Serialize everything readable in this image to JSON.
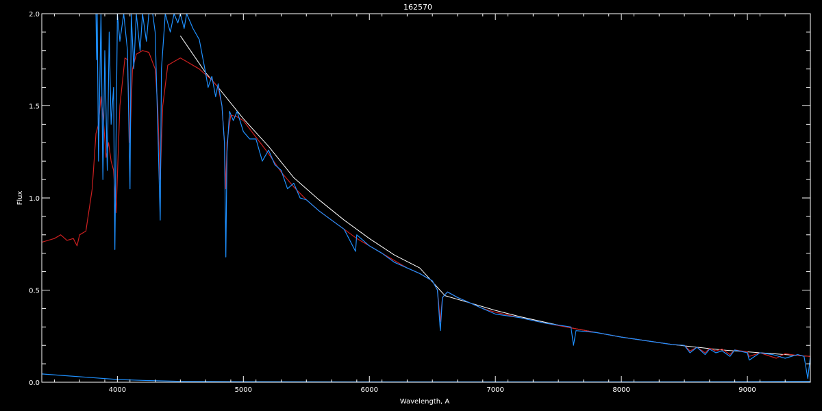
{
  "chart_data": {
    "type": "line",
    "title": "162570",
    "xlabel": "Wavelength, A",
    "ylabel": "Flux",
    "xlim": [
      3400,
      9500
    ],
    "ylim": [
      0.0,
      2.0
    ],
    "xticks": [
      4000,
      5000,
      6000,
      7000,
      8000,
      9000
    ],
    "yticks": [
      "0.0",
      "0.5",
      "1.0",
      "1.5",
      "2.0"
    ],
    "ytick_values": [
      0.0,
      0.5,
      1.0,
      1.5,
      2.0
    ],
    "grid": false,
    "legend": "none",
    "colors": {
      "background": "#000000",
      "axes": "#ffffff",
      "observed": "#1e90ff",
      "model": "#cc2020",
      "reference": "#ffffff",
      "error": "#1e90ff"
    },
    "series": [
      {
        "key": "reference",
        "x": [
          4500,
          4600,
          4700,
          4800,
          5000,
          5200,
          5400,
          5600,
          5800,
          6000,
          6200,
          6400,
          6600,
          6800,
          7000,
          7200,
          7400,
          7600,
          7800,
          8000,
          8200,
          8400,
          8600,
          8800,
          9000,
          9200,
          9400,
          9500
        ],
        "y": [
          1.88,
          1.78,
          1.68,
          1.6,
          1.43,
          1.28,
          1.11,
          0.99,
          0.88,
          0.78,
          0.69,
          0.62,
          0.47,
          0.43,
          0.39,
          0.355,
          0.325,
          0.295,
          0.27,
          0.245,
          0.225,
          0.205,
          0.19,
          0.175,
          0.165,
          0.155,
          0.145,
          0.14
        ]
      },
      {
        "key": "model",
        "x": [
          3400,
          3500,
          3550,
          3600,
          3650,
          3680,
          3700,
          3750,
          3800,
          3830,
          3850,
          3870,
          3890,
          3910,
          3930,
          3950,
          3970,
          3990,
          4020,
          4060,
          4080,
          4100,
          4120,
          4150,
          4200,
          4250,
          4300,
          4320,
          4340,
          4360,
          4400,
          4450,
          4500,
          4550,
          4600,
          4650,
          4700,
          4750,
          4800,
          4830,
          4850,
          4861,
          4870,
          4900,
          4950,
          5000,
          5100,
          5200,
          5300,
          5400,
          5500,
          5600,
          5700,
          5800,
          5900,
          6000,
          6100,
          6200,
          6300,
          6400,
          6500,
          6540,
          6563,
          6580,
          6620,
          6700,
          6800,
          6900,
          7000,
          7200,
          7400,
          7600,
          7800,
          8000,
          8200,
          8400,
          8500,
          8545,
          8600,
          8665,
          8700,
          8750,
          8800,
          8862,
          8900,
          9000,
          9015,
          9100,
          9229,
          9300,
          9400,
          9500
        ],
        "y": [
          0.76,
          0.78,
          0.8,
          0.77,
          0.78,
          0.74,
          0.8,
          0.82,
          1.05,
          1.35,
          1.4,
          1.55,
          1.42,
          1.22,
          1.3,
          1.2,
          1.15,
          0.92,
          1.5,
          1.76,
          1.75,
          1.3,
          1.7,
          1.78,
          1.8,
          1.79,
          1.7,
          1.5,
          1.1,
          1.5,
          1.72,
          1.74,
          1.76,
          1.74,
          1.72,
          1.7,
          1.67,
          1.64,
          1.6,
          1.5,
          1.3,
          1.05,
          1.3,
          1.45,
          1.44,
          1.42,
          1.33,
          1.24,
          1.14,
          1.06,
          0.99,
          0.93,
          0.88,
          0.83,
          0.78,
          0.74,
          0.7,
          0.66,
          0.62,
          0.59,
          0.55,
          0.5,
          0.33,
          0.46,
          0.49,
          0.46,
          0.43,
          0.4,
          0.38,
          0.35,
          0.32,
          0.295,
          0.27,
          0.245,
          0.225,
          0.205,
          0.2,
          0.17,
          0.19,
          0.16,
          0.185,
          0.17,
          0.18,
          0.15,
          0.175,
          0.165,
          0.14,
          0.16,
          0.13,
          0.155,
          0.145,
          0.14
        ]
      },
      {
        "key": "observed",
        "x": [
          3830,
          3835,
          3840,
          3850,
          3870,
          3885,
          3900,
          3920,
          3935,
          3950,
          3970,
          3980,
          4000,
          4020,
          4050,
          4080,
          4100,
          4110,
          4130,
          4150,
          4180,
          4200,
          4230,
          4250,
          4280,
          4300,
          4320,
          4340,
          4350,
          4380,
          4400,
          4420,
          4450,
          4480,
          4500,
          4530,
          4550,
          4600,
          4650,
          4700,
          4720,
          4750,
          4780,
          4800,
          4830,
          4850,
          4861,
          4870,
          4890,
          4920,
          4950,
          5000,
          5050,
          5100,
          5150,
          5200,
          5250,
          5300,
          5350,
          5400,
          5450,
          5500,
          5600,
          5700,
          5800,
          5890,
          5900,
          6000,
          6100,
          6200,
          6300,
          6400,
          6500,
          6540,
          6563,
          6580,
          6620,
          6700,
          6800,
          6900,
          7000,
          7200,
          7400,
          7600,
          7620,
          7640,
          7800,
          8000,
          8200,
          8400,
          8500,
          8545,
          8600,
          8665,
          8700,
          8750,
          8800,
          8862,
          8900,
          9000,
          9015,
          9100,
          9200,
          9300,
          9400,
          9450,
          9480,
          9500
        ],
        "y": [
          2.0,
          1.75,
          2.0,
          1.2,
          2.0,
          1.1,
          1.8,
          1.15,
          1.9,
          1.4,
          1.6,
          0.72,
          2.0,
          1.85,
          2.0,
          1.8,
          1.05,
          2.0,
          1.7,
          2.0,
          1.8,
          2.0,
          1.85,
          2.0,
          2.0,
          1.9,
          1.4,
          0.88,
          1.7,
          2.0,
          1.95,
          1.9,
          2.0,
          1.95,
          2.0,
          1.92,
          2.0,
          1.92,
          1.86,
          1.68,
          1.6,
          1.66,
          1.55,
          1.62,
          1.5,
          1.3,
          0.68,
          1.25,
          1.47,
          1.42,
          1.47,
          1.36,
          1.32,
          1.32,
          1.2,
          1.26,
          1.18,
          1.15,
          1.05,
          1.08,
          1.0,
          0.99,
          0.93,
          0.88,
          0.83,
          0.71,
          0.8,
          0.74,
          0.7,
          0.65,
          0.62,
          0.59,
          0.55,
          0.5,
          0.28,
          0.46,
          0.49,
          0.46,
          0.43,
          0.4,
          0.37,
          0.35,
          0.32,
          0.3,
          0.2,
          0.28,
          0.27,
          0.245,
          0.225,
          0.205,
          0.2,
          0.16,
          0.19,
          0.15,
          0.18,
          0.16,
          0.17,
          0.14,
          0.175,
          0.16,
          0.12,
          0.16,
          0.15,
          0.13,
          0.15,
          0.14,
          0.02,
          0.14
        ]
      },
      {
        "key": "error",
        "x": [
          3400,
          3600,
          3800,
          4000,
          4200,
          4500,
          5000,
          6000,
          7000,
          8000,
          9000,
          9500
        ],
        "y": [
          0.045,
          0.035,
          0.025,
          0.015,
          0.01,
          0.005,
          0.003,
          0.002,
          0.002,
          0.002,
          0.003,
          0.004
        ]
      }
    ]
  }
}
